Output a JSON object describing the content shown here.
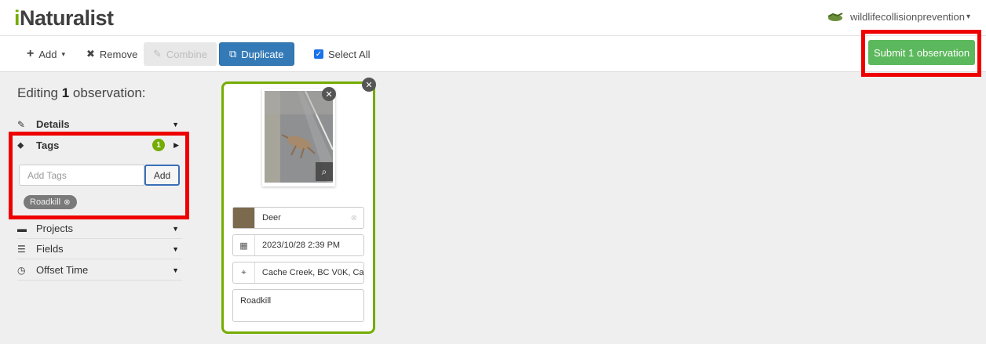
{
  "header": {
    "logo_prefix": "i",
    "logo_rest": "Naturalist",
    "username": "wildlifecollisionprevention",
    "user_caret": "▾"
  },
  "toolbar": {
    "add_label": "Add",
    "remove_label": "Remove",
    "combine_label": "Combine",
    "duplicate_label": "Duplicate",
    "select_all_label": "Select All",
    "submit_label": "Submit 1 observation"
  },
  "sidebar": {
    "editing_prefix": "Editing",
    "editing_count": "1",
    "editing_suffix": "observation:",
    "details_label": "Details",
    "tags_label": "Tags",
    "tags_count": "1",
    "tag_placeholder": "Add Tags",
    "tag_add_label": "Add",
    "tags": [
      "Roadkill"
    ],
    "projects_label": "Projects",
    "fields_label": "Fields",
    "offset_time_label": "Offset Time"
  },
  "observation": {
    "species": "Deer",
    "datetime": "2023/10/28 2:39 PM",
    "location": "Cache Creek, BC V0K, Ca",
    "description": "Roadkill"
  },
  "colors": {
    "brand_green": "#74ac00",
    "submit_green": "#5cb85c",
    "primary_blue": "#337ab7",
    "highlight_red": "#ee0000"
  }
}
